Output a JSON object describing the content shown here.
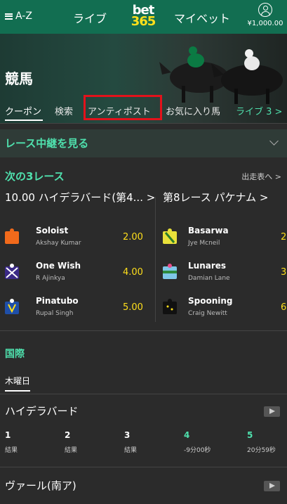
{
  "header": {
    "menu_label": "A-Z",
    "live_label": "ライブ",
    "logo_top": "bet",
    "logo_bottom": "365",
    "mybets_label": "マイベット",
    "balance": "¥1,000.00"
  },
  "hero": {
    "title": "競馬"
  },
  "tabs": [
    {
      "label": "クーポン"
    },
    {
      "label": "検索"
    },
    {
      "label": "アンティポスト"
    },
    {
      "label": "お気に入り馬"
    },
    {
      "label": "ライブ 3 >"
    }
  ],
  "stream": {
    "label": "レース中継を見る"
  },
  "next_races": {
    "heading": "次の3レース",
    "racecard_link": "出走表へ >",
    "races": [
      {
        "title": "10.00 ハイデラバード(第4...  >",
        "runners": [
          {
            "name": "Soloist",
            "jockey": "Akshay Kumar",
            "odds": "2.00"
          },
          {
            "name": "One Wish",
            "jockey": "R Ajinkya",
            "odds": "4.00"
          },
          {
            "name": "Pinatubo",
            "jockey": "Rupal Singh",
            "odds": "5.00"
          }
        ]
      },
      {
        "title": "第8レース パケナム >",
        "runners": [
          {
            "name": "Basarwa",
            "jockey": "Jye Mcneil",
            "odds": "2"
          },
          {
            "name": "Lunares",
            "jockey": "Damian Lane",
            "odds": "3"
          },
          {
            "name": "Spooning",
            "jockey": "Craig Newitt",
            "odds": "6"
          }
        ]
      }
    ]
  },
  "international": {
    "heading": "国際",
    "day_tab": "木曜日",
    "meetings": [
      {
        "name": "ハイデラバード",
        "races": [
          {
            "num": "1",
            "status": "結果"
          },
          {
            "num": "2",
            "status": "結果"
          },
          {
            "num": "3",
            "status": "結果"
          },
          {
            "num": "4",
            "status": "-9分00秒"
          },
          {
            "num": "5",
            "status": "20分59秒"
          }
        ]
      },
      {
        "name": "ヴァール(南ア)"
      }
    ]
  },
  "colors": {
    "header_green": "#126e51",
    "accent_green": "#4fe0ad",
    "odds_yellow": "#ffdf1b",
    "highlight_red": "#e2121b",
    "background": "#2b2b2b"
  }
}
